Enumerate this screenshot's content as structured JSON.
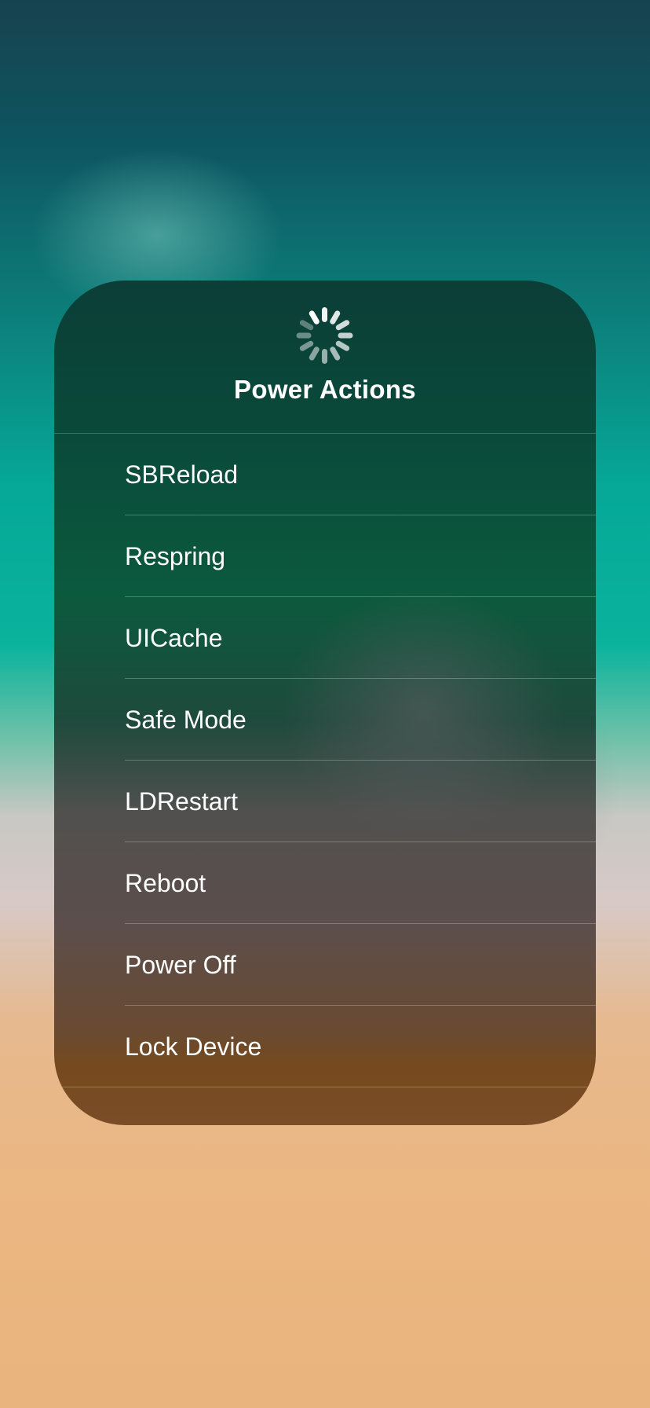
{
  "panel": {
    "title": "Power Actions",
    "spinner_icon": "activity-spinner-icon",
    "items": [
      {
        "label": "SBReload"
      },
      {
        "label": "Respring"
      },
      {
        "label": "UICache"
      },
      {
        "label": "Safe Mode"
      },
      {
        "label": "LDRestart"
      },
      {
        "label": "Reboot"
      },
      {
        "label": "Power Off"
      },
      {
        "label": "Lock Device"
      }
    ]
  },
  "colors": {
    "text": "#ffffff",
    "panel_top": "#0b3e37",
    "panel_bottom": "#764a1d"
  }
}
